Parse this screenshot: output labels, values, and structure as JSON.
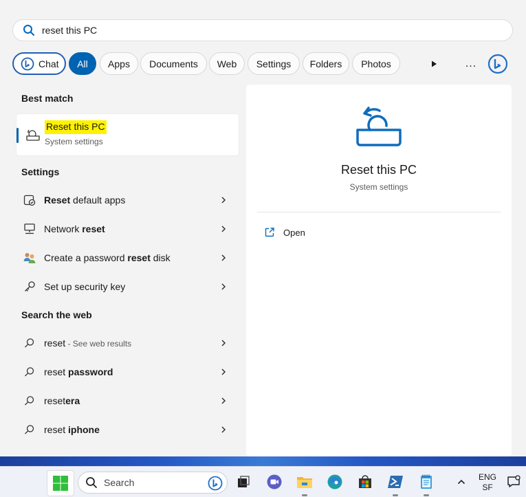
{
  "search": {
    "query": "reset this PC",
    "icon": "search-icon"
  },
  "chips": {
    "chat": "Chat",
    "all": "All",
    "apps": "Apps",
    "documents": "Documents",
    "web": "Web",
    "settings": "Settings",
    "folders": "Folders",
    "photos": "Photos",
    "more": "..."
  },
  "best_match": {
    "section": "Best match",
    "title": "Reset this PC",
    "subtitle": "System settings",
    "highlight_color": "#fff200"
  },
  "settings": {
    "section": "Settings",
    "items": [
      {
        "pre": "",
        "bold": "Reset",
        "post": " default apps",
        "icon": "default-apps-icon"
      },
      {
        "pre": "Network ",
        "bold": "reset",
        "post": "",
        "icon": "network-pc-icon"
      },
      {
        "pre": "Create a password ",
        "bold": "reset",
        "post": " disk",
        "icon": "users-icon"
      },
      {
        "pre": "Set up security key",
        "bold": "",
        "post": "",
        "icon": "key-icon"
      }
    ]
  },
  "web": {
    "section": "Search the web",
    "items": [
      {
        "pre": "reset",
        "bold": "",
        "post": "",
        "sub": " - See web results"
      },
      {
        "pre": "reset ",
        "bold": "password",
        "post": "",
        "sub": ""
      },
      {
        "pre": "reset",
        "bold": "era",
        "post": "",
        "sub": ""
      },
      {
        "pre": "reset ",
        "bold": "iphone",
        "post": "",
        "sub": ""
      }
    ]
  },
  "preview": {
    "title": "Reset this PC",
    "subtitle": "System settings",
    "open_label": "Open"
  },
  "taskbar": {
    "search_placeholder": "Search",
    "lang_top": "ENG",
    "lang_bottom": "SF"
  },
  "colors": {
    "accent": "#0063b1",
    "background": "#f3f3f3"
  }
}
